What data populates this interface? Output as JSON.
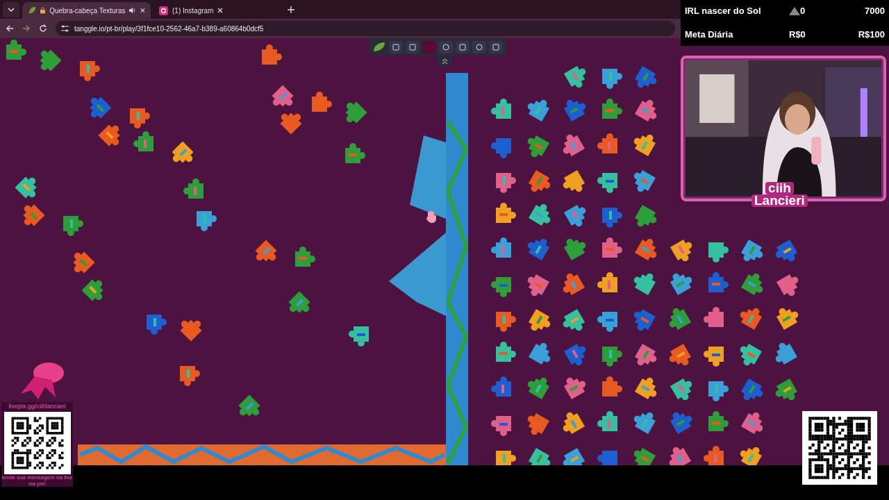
{
  "browser": {
    "tabs": [
      {
        "kind": "game",
        "title": "Quebra-cabeça Texturas",
        "audio": true,
        "selected": true
      },
      {
        "kind": "instagram",
        "title": "(1) Instagram",
        "audio": false,
        "selected": false
      }
    ],
    "url": "tanggle.io/pt-br/play/3f1fce10-2562-46a7-b389-a60864b0dcf5"
  },
  "goals": [
    {
      "label": "IRL nascer do Sol",
      "current": "0",
      "target": "7000",
      "kind": "subs"
    },
    {
      "label": "Meta Diária",
      "current": "R$0",
      "target": "R$100",
      "kind": "money"
    }
  ],
  "streamer_name": [
    "ciih",
    "Lancieri"
  ],
  "donation": {
    "link": "livepix.gg/ciihlancieri",
    "message": "envie sua mensagem na live via pix!"
  }
}
